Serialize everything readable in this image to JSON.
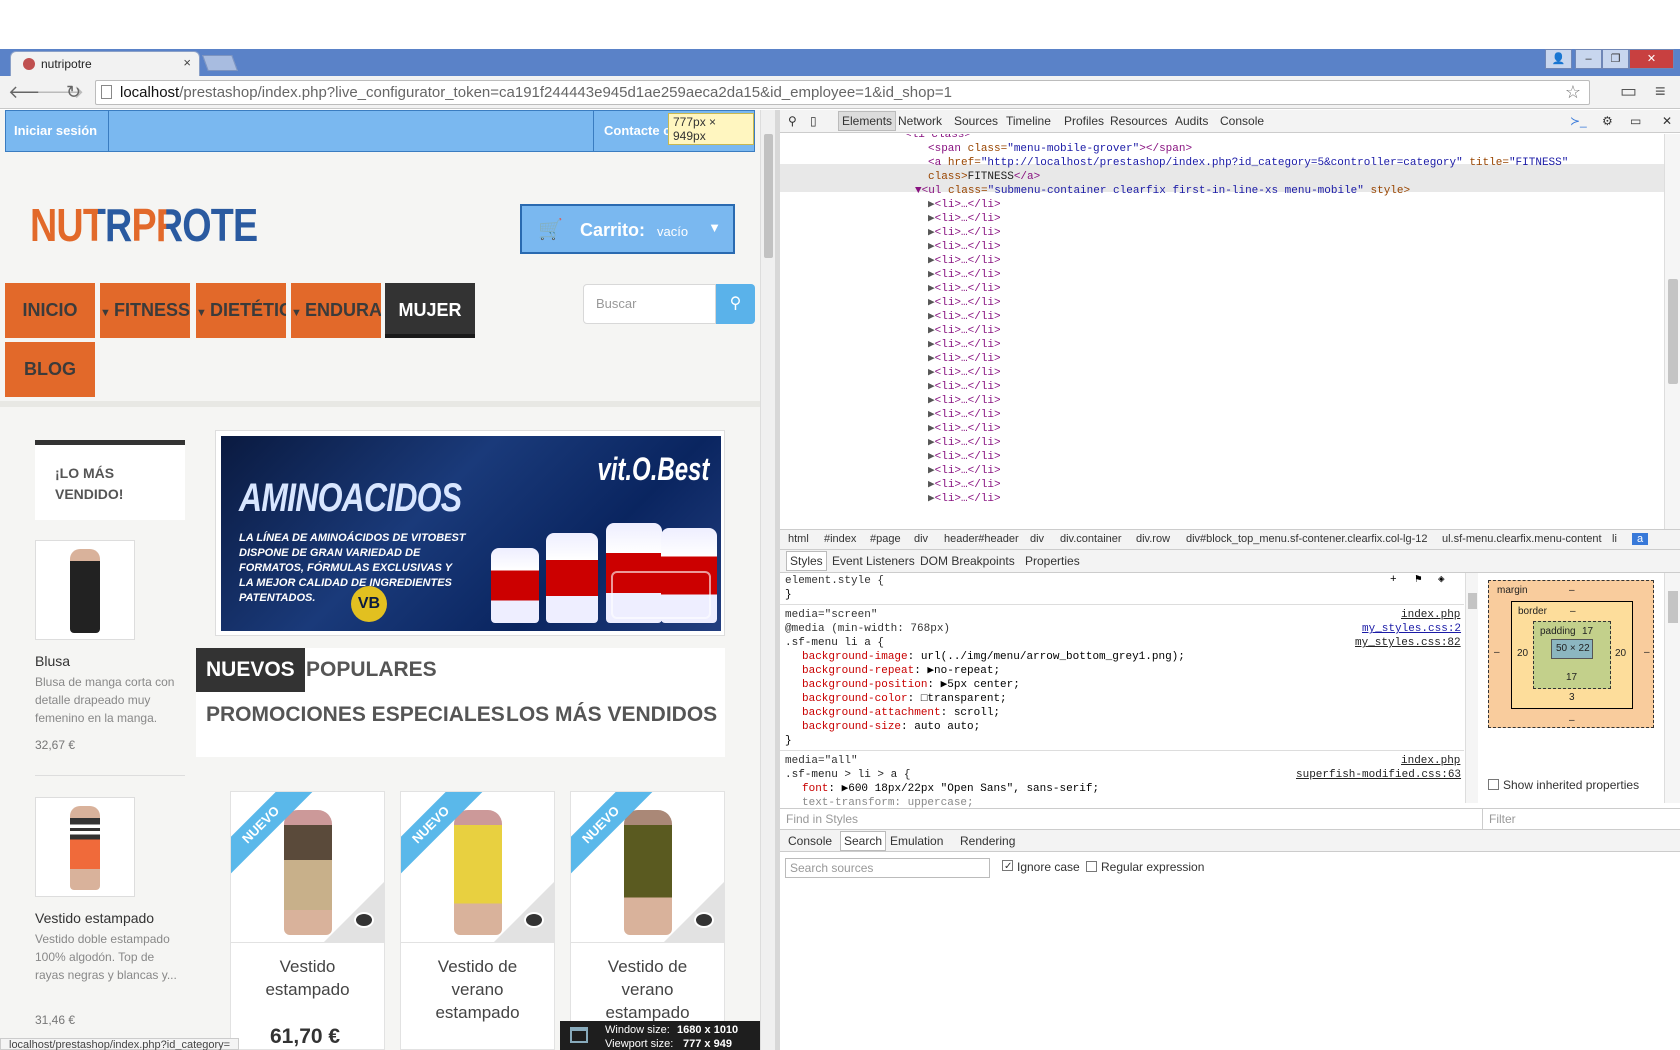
{
  "browser": {
    "tab_title": "nutripotre",
    "tab_close": "×",
    "url_host": "localhost",
    "url_path": "/prestashop/index.php?live_configurator_token=ca191f244443e945d1ae259aeca2da15&id_employee=1&id_shop=1",
    "back": "🡐",
    "forward": "🡒",
    "reload": "↻",
    "star": "☆",
    "menu": "≡"
  },
  "page": {
    "login": "Iniciar sesión",
    "contact": "Contacte con nosotros",
    "dim_tooltip": "777px × 949px",
    "logo": "NUTRPROTE",
    "cart_label": "Carrito:",
    "cart_status": "vacío",
    "menu": [
      "INICIO",
      "FITNESS",
      "DIETÉTICA",
      "ENDURANCE",
      "MUJER",
      "BLOG"
    ],
    "search_placeholder": "Buscar",
    "bestseller_title": "¡LO MÁS VENDIDO!",
    "side_products": [
      {
        "name": "Blusa",
        "desc": "Blusa de manga corta con detalle drapeado muy femenino en la manga.",
        "price": "32,67 €"
      },
      {
        "name": "Vestido estampado",
        "desc": "Vestido doble estampado 100% algodón. Top de rayas negras y blancas y...",
        "price": "31,46 €"
      }
    ],
    "banner": {
      "title": "AMINOACIDOS",
      "brand": "vit.O.Best",
      "text": "LA LÍNEA DE AMINOÁCIDOS DE VITOBEST DISPONE DE GRAN VARIEDAD DE FORMATOS, FÓRMULAS EXCLUSIVAS Y LA MEJOR CALIDAD DE INGREDIENTES PATENTADOS.",
      "mark": "VB"
    },
    "tabs": [
      "NUEVOS",
      "POPULARES",
      "PROMOCIONES ESPECIALES",
      "LOS MÁS VENDIDOS"
    ],
    "ribbon": "NUEVO",
    "products": [
      {
        "name": "Vestido estampado"
      },
      {
        "name": "Vestido de verano estampado"
      },
      {
        "name": "Vestido de verano estampado"
      }
    ],
    "price": "61,70 €",
    "status_url": "localhost/prestashop/index.php?id_category=",
    "window_size_label": "Window size:",
    "window_size_value": "1680 x 1010",
    "viewport_size_label": "Viewport size:",
    "viewport_size_value": "777 x 949"
  },
  "devtools": {
    "tabs": [
      "Elements",
      "Network",
      "Sources",
      "Timeline",
      "Profiles",
      "Resources",
      "Audits",
      "Console"
    ],
    "dom": {
      "l0": "<li class>",
      "span_tag": "<span",
      "span_attr": "class=",
      "span_val": "\"menu-mobile-grover\"",
      "span_close": "></span>",
      "a_tag": "<a",
      "a_href_attr": "href=",
      "a_href": "\"http://localhost/prestashop/index.php?id_category=5&controller=category\"",
      "a_title_attr": "title=",
      "a_title": "\"FITNESS\"",
      "a_class": "class>",
      "a_text": "FITNESS",
      "a_close": "</a>",
      "ul_tag": "▼<ul",
      "ul_attr": "class=",
      "ul_val": "\"submenu-container clearfix first-in-line-xs menu-mobile\"",
      "ul_style": "style>",
      "li_item": "<li>…</li>",
      "li_count": 22
    },
    "breadcrumbs": [
      "html",
      "#index",
      "#page",
      "div",
      "header#header",
      "div",
      "div.container",
      "div.row",
      "div#block_top_menu.sf-contener.clearfix.col-lg-12",
      "ul.sf-menu.clearfix.menu-content",
      "li",
      "a"
    ],
    "subtabs": [
      "Styles",
      "Event Listeners",
      "DOM Breakpoints",
      "Properties"
    ],
    "styles": {
      "element_style": "element.style {",
      "close": "}",
      "media_screen": "media=\"screen\"",
      "media_rule": "@media (min-width: 768px)",
      "selector1": ".sf-menu li a {",
      "src_index": "index.php",
      "src_my1": "my_styles.css:2",
      "src_my2": "my_styles.css:82",
      "props": [
        {
          "k": "background-image",
          "v": "url(../img/menu/arrow_bottom_grey1.png);"
        },
        {
          "k": "background-repeat",
          "v": "▶no-repeat;"
        },
        {
          "k": "background-position",
          "v": "▶5px center;"
        },
        {
          "k": "background-color",
          "v": "□transparent;"
        },
        {
          "k": "background-attachment",
          "v": "scroll;"
        },
        {
          "k": "background-size",
          "v": "auto auto;"
        }
      ],
      "media_all": "media=\"all\"",
      "selector2": ".sf-menu > li > a {",
      "src_index2": "index.php",
      "src_super": "superfish-modified.css:63",
      "font_k": "font",
      "font_v": "▶600 18px/22px \"Open Sans\", sans-serif;",
      "text_transform": "text-transform: uppercase;"
    },
    "boxmodel": {
      "margin": "margin",
      "margin_v": "–",
      "border": "border",
      "border_v": "–",
      "padding": "padding",
      "padding_top": "17",
      "padding_bottom": "17",
      "padding_left": "20",
      "padding_right": "20",
      "content": "50 × 22",
      "outer_bottom": "3",
      "margin_bottom": "–",
      "margin_left": "–",
      "margin_right": "–"
    },
    "show_inherited": "Show inherited properties",
    "find_in_styles": "Find in Styles",
    "filter": "Filter",
    "drawer_tabs": [
      "Console",
      "Search",
      "Emulation",
      "Rendering"
    ],
    "search_sources": "Search sources",
    "ignore_case": "Ignore case",
    "regex": "Regular expression"
  },
  "colors": {
    "accent_orange": "#e2692a",
    "accent_blue": "#7ab8f0",
    "devtools_select": "#3879d9"
  }
}
